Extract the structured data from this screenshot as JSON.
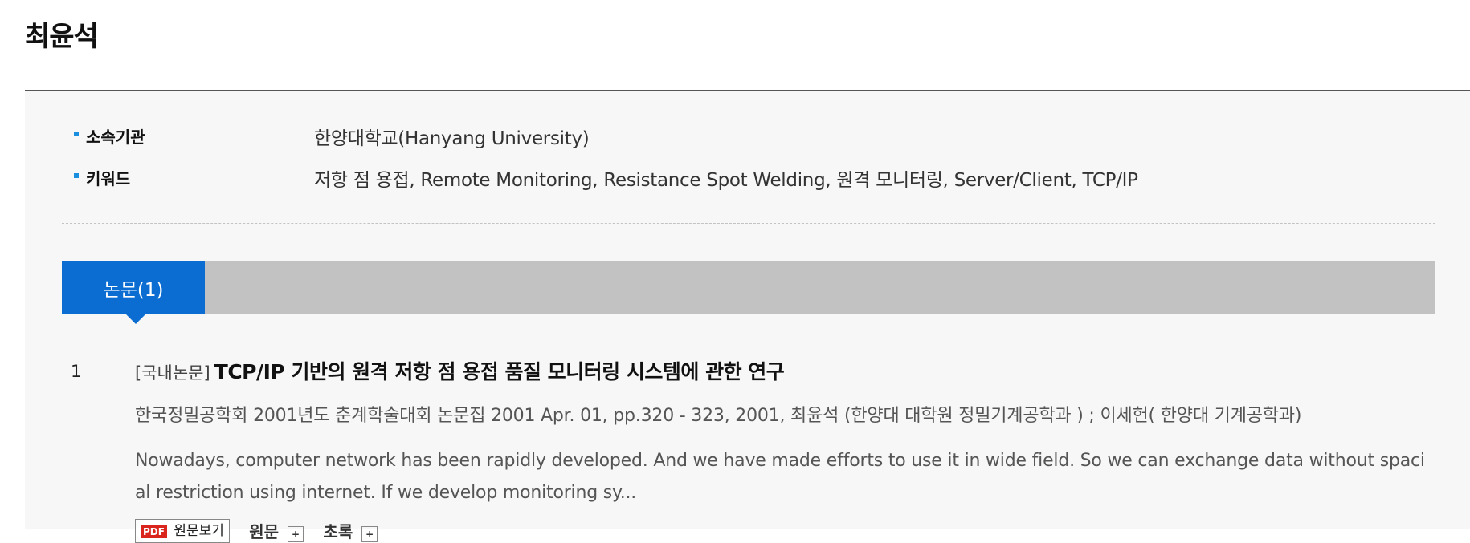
{
  "page": {
    "title": "최윤석"
  },
  "info": {
    "affiliation": {
      "label": "소속기관",
      "value": "한양대학교(Hanyang University)"
    },
    "keywords": {
      "label": "키워드",
      "value": "저항 점 용접, Remote Monitoring, Resistance Spot Welding, 원격 모니터링, Server/Client, TCP/IP"
    }
  },
  "tabs": [
    {
      "label": "논문(1)",
      "active": true
    }
  ],
  "results": [
    {
      "number": "1",
      "type": "[국내논문]",
      "title": "TCP/IP 기반의 원격 저항 점 용접 품질 모니터링 시스템에 관한 연구",
      "meta": "한국정밀공학회 2001년도 춘계학술대회 논문집 2001 Apr. 01, pp.320 - 323, 2001,  최윤석 (한양대 대학원 정밀기계공학과 ) ; 이세헌( 한양대 기계공학과)",
      "abstract": "Nowadays, computer network has been rapidly developed. And we have made efforts to use it in wide field. So we can exchange data without spacial restriction using internet. If we develop monitoring sy...",
      "actions": {
        "pdf_badge": "PDF",
        "pdf_label": "원문보기",
        "abstract_label": "원문",
        "toc_label": "초록",
        "toggle": "+"
      }
    }
  ],
  "colors": {
    "accent": "#0b6dd1",
    "bullet": "#1a8fe0",
    "tab_bar": "#c1c2c1",
    "panel_bg": "#f7f7f7",
    "pdf_red": "#d9251c"
  }
}
